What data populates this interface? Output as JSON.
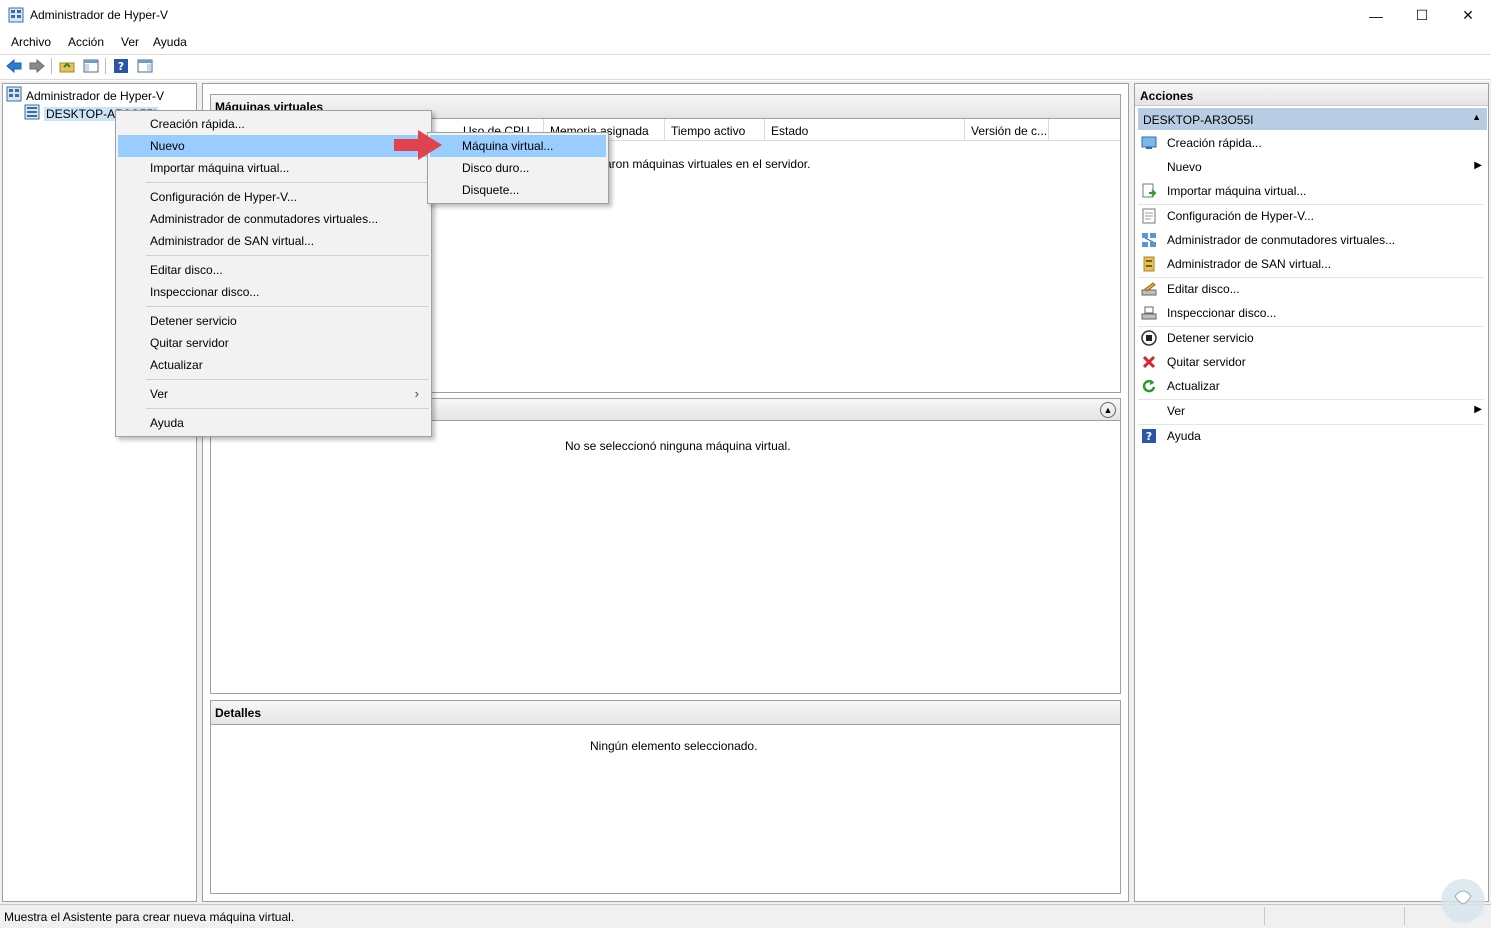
{
  "window": {
    "title": "Administrador de Hyper-V",
    "minimize": "—",
    "maximize": "☐",
    "close": "✕"
  },
  "menubar": [
    "Archivo",
    "Acción",
    "Ver",
    "Ayuda"
  ],
  "tree": {
    "root": "Administrador de Hyper-V",
    "server": "DESKTOP-AR3O55I"
  },
  "vm_panel": {
    "title": "Máquinas virtuales",
    "columns": [
      "Uso de CPU",
      "Memoria asignada",
      "Tiempo activo",
      "Estado",
      "Versión de c..."
    ],
    "empty_text": "aron máquinas virtuales en el servidor."
  },
  "checkpoint_panel": {
    "empty_text": "No se seleccionó ninguna máquina virtual."
  },
  "details_panel": {
    "title": "Detalles",
    "empty_text": "Ningún elemento seleccionado."
  },
  "actions": {
    "title": "Acciones",
    "server": "DESKTOP-AR3O55I",
    "items": [
      "Creación rápida...",
      "Nuevo",
      "Importar máquina virtual...",
      "Configuración de Hyper-V...",
      "Administrador de conmutadores virtuales...",
      "Administrador de SAN virtual...",
      "Editar disco...",
      "Inspeccionar disco...",
      "Detener servicio",
      "Quitar servidor",
      "Actualizar",
      "Ver",
      "Ayuda"
    ]
  },
  "context_menu": {
    "items": [
      "Creación rápida...",
      "Nuevo",
      "Importar máquina virtual...",
      "Configuración de Hyper-V...",
      "Administrador de conmutadores virtuales...",
      "Administrador de SAN virtual...",
      "Editar disco...",
      "Inspeccionar disco...",
      "Detener servicio",
      "Quitar servidor",
      "Actualizar",
      "Ver",
      "Ayuda"
    ]
  },
  "submenu": {
    "items": [
      "Máquina virtual...",
      "Disco duro...",
      "Disquete..."
    ]
  },
  "statusbar": {
    "text": "Muestra el Asistente para crear nueva máquina virtual."
  },
  "colors": {
    "highlight": "#99ccff",
    "server_header": "#b8cde4",
    "arrow": "#e0424e"
  }
}
